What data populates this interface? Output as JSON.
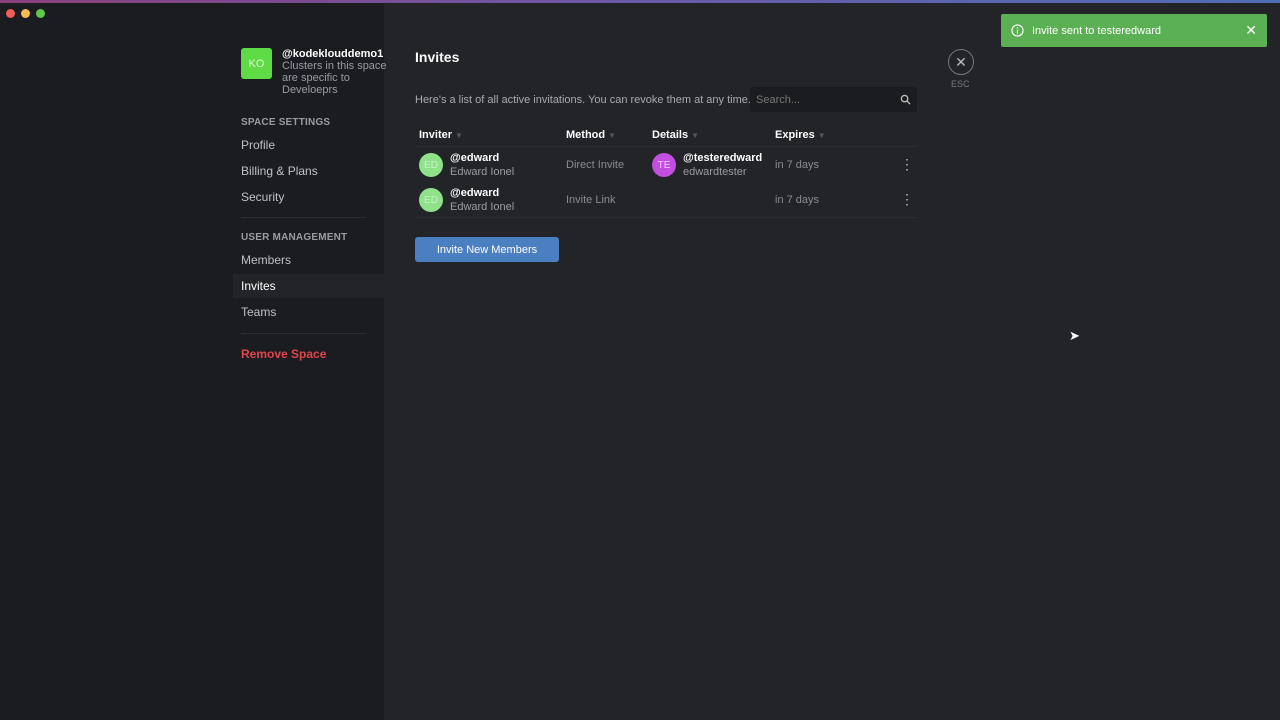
{
  "window": {
    "controls": {
      "close": "#ee5d5a",
      "minimize": "#f5bd4f",
      "maximize": "#5fc84a"
    }
  },
  "space": {
    "initials": "KO",
    "name": "@kodeklouddemo1",
    "description": "Clusters in this space are specific to Develoeprs"
  },
  "sidebar": {
    "space_settings_heading": "SPACE SETTINGS",
    "space_settings": [
      {
        "label": "Profile"
      },
      {
        "label": "Billing & Plans"
      },
      {
        "label": "Security"
      }
    ],
    "user_management_heading": "USER MANAGEMENT",
    "user_management": [
      {
        "label": "Members"
      },
      {
        "label": "Invites",
        "active": true
      },
      {
        "label": "Teams"
      }
    ],
    "remove_label": "Remove Space"
  },
  "main": {
    "title": "Invites",
    "description": "Here's a list of all active invitations. You can revoke them at any time.",
    "search_placeholder": "Search...",
    "columns": [
      "Inviter",
      "Method",
      "Details",
      "Expires"
    ],
    "rows": [
      {
        "inviter_initials": "ED",
        "inviter_handle": "@edward",
        "inviter_name": "Edward Ionel",
        "method": "Direct Invite",
        "details_initials": "TE",
        "details_handle": "@testeredward",
        "details_name": "edwardtester",
        "expires": "in 7 days"
      },
      {
        "inviter_initials": "ED",
        "inviter_handle": "@edward",
        "inviter_name": "Edward Ionel",
        "method": "Invite Link",
        "expires": "in 7 days"
      }
    ],
    "invite_button": "Invite New Members"
  },
  "close": {
    "label": "ESC"
  },
  "toast": {
    "message": "Invite sent to testeredward",
    "color": "#5cb054"
  }
}
